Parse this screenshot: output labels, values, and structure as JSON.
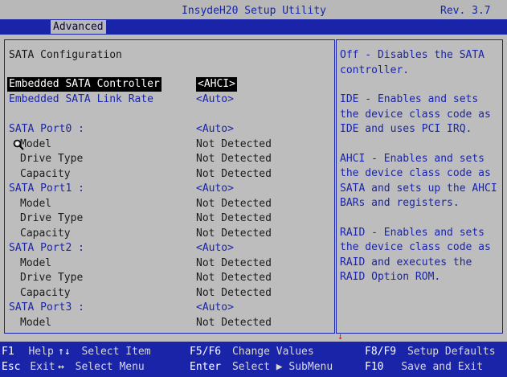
{
  "window": {
    "title": "InsydeH20 Setup Utility",
    "rev": "Rev. 3.7"
  },
  "menu": {
    "tabs": [
      {
        "label": "Advanced"
      }
    ]
  },
  "main": {
    "heading": "SATA Configuration",
    "rows": [
      {
        "label": "Embedded SATA Controller",
        "value": "<AHCI>"
      },
      {
        "label": "Embedded SATA Link Rate",
        "value": "<Auto>"
      },
      {
        "label": "SATA Port0 :",
        "value": "<Auto>"
      },
      {
        "label": "Model",
        "value": "Not Detected"
      },
      {
        "label": "Drive Type",
        "value": "Not Detected"
      },
      {
        "label": "Capacity",
        "value": "Not Detected"
      },
      {
        "label": "SATA Port1 :",
        "value": "<Auto>"
      },
      {
        "label": "Model",
        "value": "Not Detected"
      },
      {
        "label": "Drive Type",
        "value": "Not Detected"
      },
      {
        "label": "Capacity",
        "value": "Not Detected"
      },
      {
        "label": "SATA Port2 :",
        "value": "<Auto>"
      },
      {
        "label": "Model",
        "value": "Not Detected"
      },
      {
        "label": "Drive Type",
        "value": "Not Detected"
      },
      {
        "label": "Capacity",
        "value": "Not Detected"
      },
      {
        "label": "SATA Port3 :",
        "value": "<Auto>"
      },
      {
        "label": "Model",
        "value": "Not Detected"
      }
    ]
  },
  "help": {
    "paragraphs": [
      "Off - Disables the SATA controller.",
      "IDE - Enables and sets the device class code as IDE and uses PCI IRQ.",
      "AHCI - Enables and sets the device class code as SATA and sets up the AHCI BARs and registers.",
      "RAID - Enables and sets the device class code as RAID and executes the RAID Option ROM."
    ]
  },
  "footer": {
    "f1_key": "F1",
    "f1_action": "Help",
    "esc_key": "Esc",
    "esc_action": "Exit",
    "updown_key": "↑↓",
    "updown_action": "Select Item",
    "lr_key": "↔",
    "lr_action": "Select Menu",
    "f5f6_key": "F5/F6",
    "f5f6_action": "Change Values",
    "enter_key": "Enter",
    "enter_action": "Select ▶ SubMenu",
    "f8f9_key": "F8/F9",
    "f8f9_action": "Setup Defaults",
    "f10_key": "F10",
    "f10_action": "Save and Exit"
  },
  "colors": {
    "accent": "#1a24a8",
    "background": "#bdbdbd",
    "scroll_arrow": "#e01818"
  },
  "icons": {
    "cursor": "magnifier-cursor-icon",
    "scroll": "scroll-down-arrow-icon"
  }
}
